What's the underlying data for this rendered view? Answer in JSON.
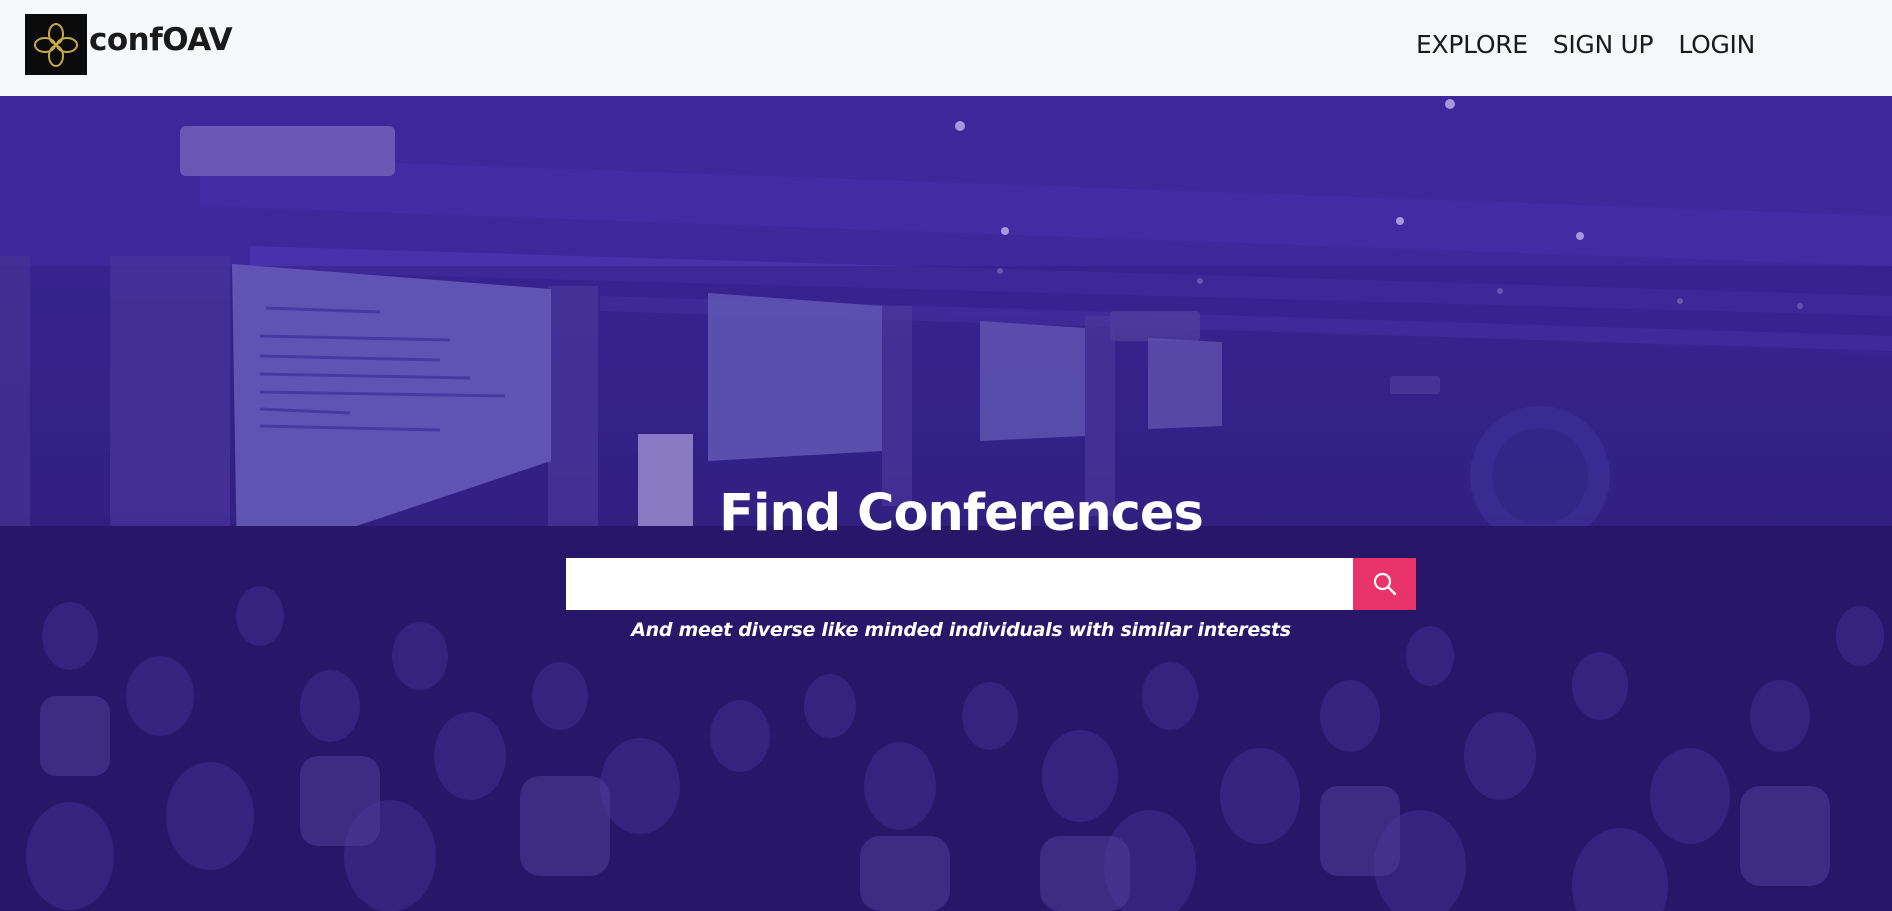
{
  "brand": {
    "name": "confOAV",
    "logo_icon": "four-petal-knot-icon"
  },
  "nav": {
    "items": [
      {
        "label": "EXPLORE"
      },
      {
        "label": "SIGN UP"
      },
      {
        "label": "LOGIN"
      }
    ]
  },
  "hero": {
    "title": "Find Conferences",
    "subtitle": "And meet diverse like minded individuals with similar interests",
    "search": {
      "value": "",
      "placeholder": "",
      "button_icon": "search-icon"
    },
    "background": "conference-hall-audience-photo"
  },
  "colors": {
    "navbar_bg": "#f7f8fa",
    "accent": "#e8336b",
    "hero_tint": "#3a2a8c"
  }
}
